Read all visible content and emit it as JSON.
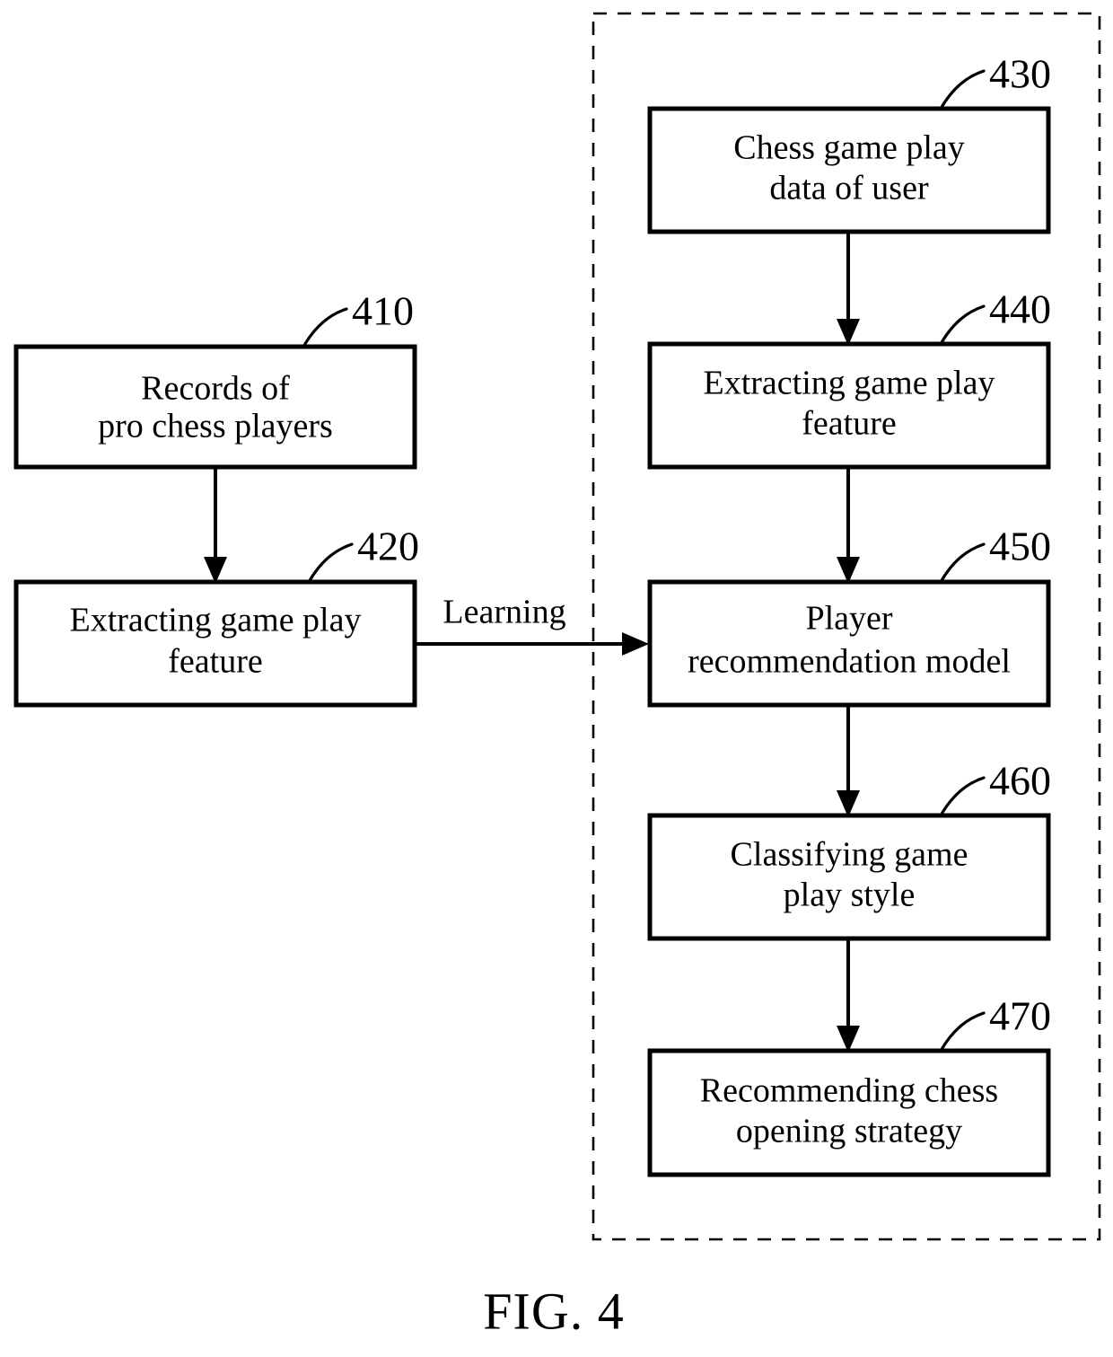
{
  "figure": {
    "caption": "FIG. 4",
    "line_color": "#000000",
    "background_color": "#ffffff"
  },
  "edge_labels": {
    "learning": "Learning"
  },
  "boxes": {
    "b410": {
      "ref": "410",
      "line1": "Records of",
      "line2": "pro chess players"
    },
    "b420": {
      "ref": "420",
      "line1": "Extracting game play",
      "line2": "feature"
    },
    "b430": {
      "ref": "430",
      "line1": "Chess game play",
      "line2": "data of user"
    },
    "b440": {
      "ref": "440",
      "line1": "Extracting game play",
      "line2": "feature"
    },
    "b450": {
      "ref": "450",
      "line1": "Player",
      "line2": "recommendation model"
    },
    "b460": {
      "ref": "460",
      "line1": "Classifying game",
      "line2": "play style"
    },
    "b470": {
      "ref": "470",
      "line1": "Recommending chess",
      "line2": "opening strategy"
    }
  }
}
